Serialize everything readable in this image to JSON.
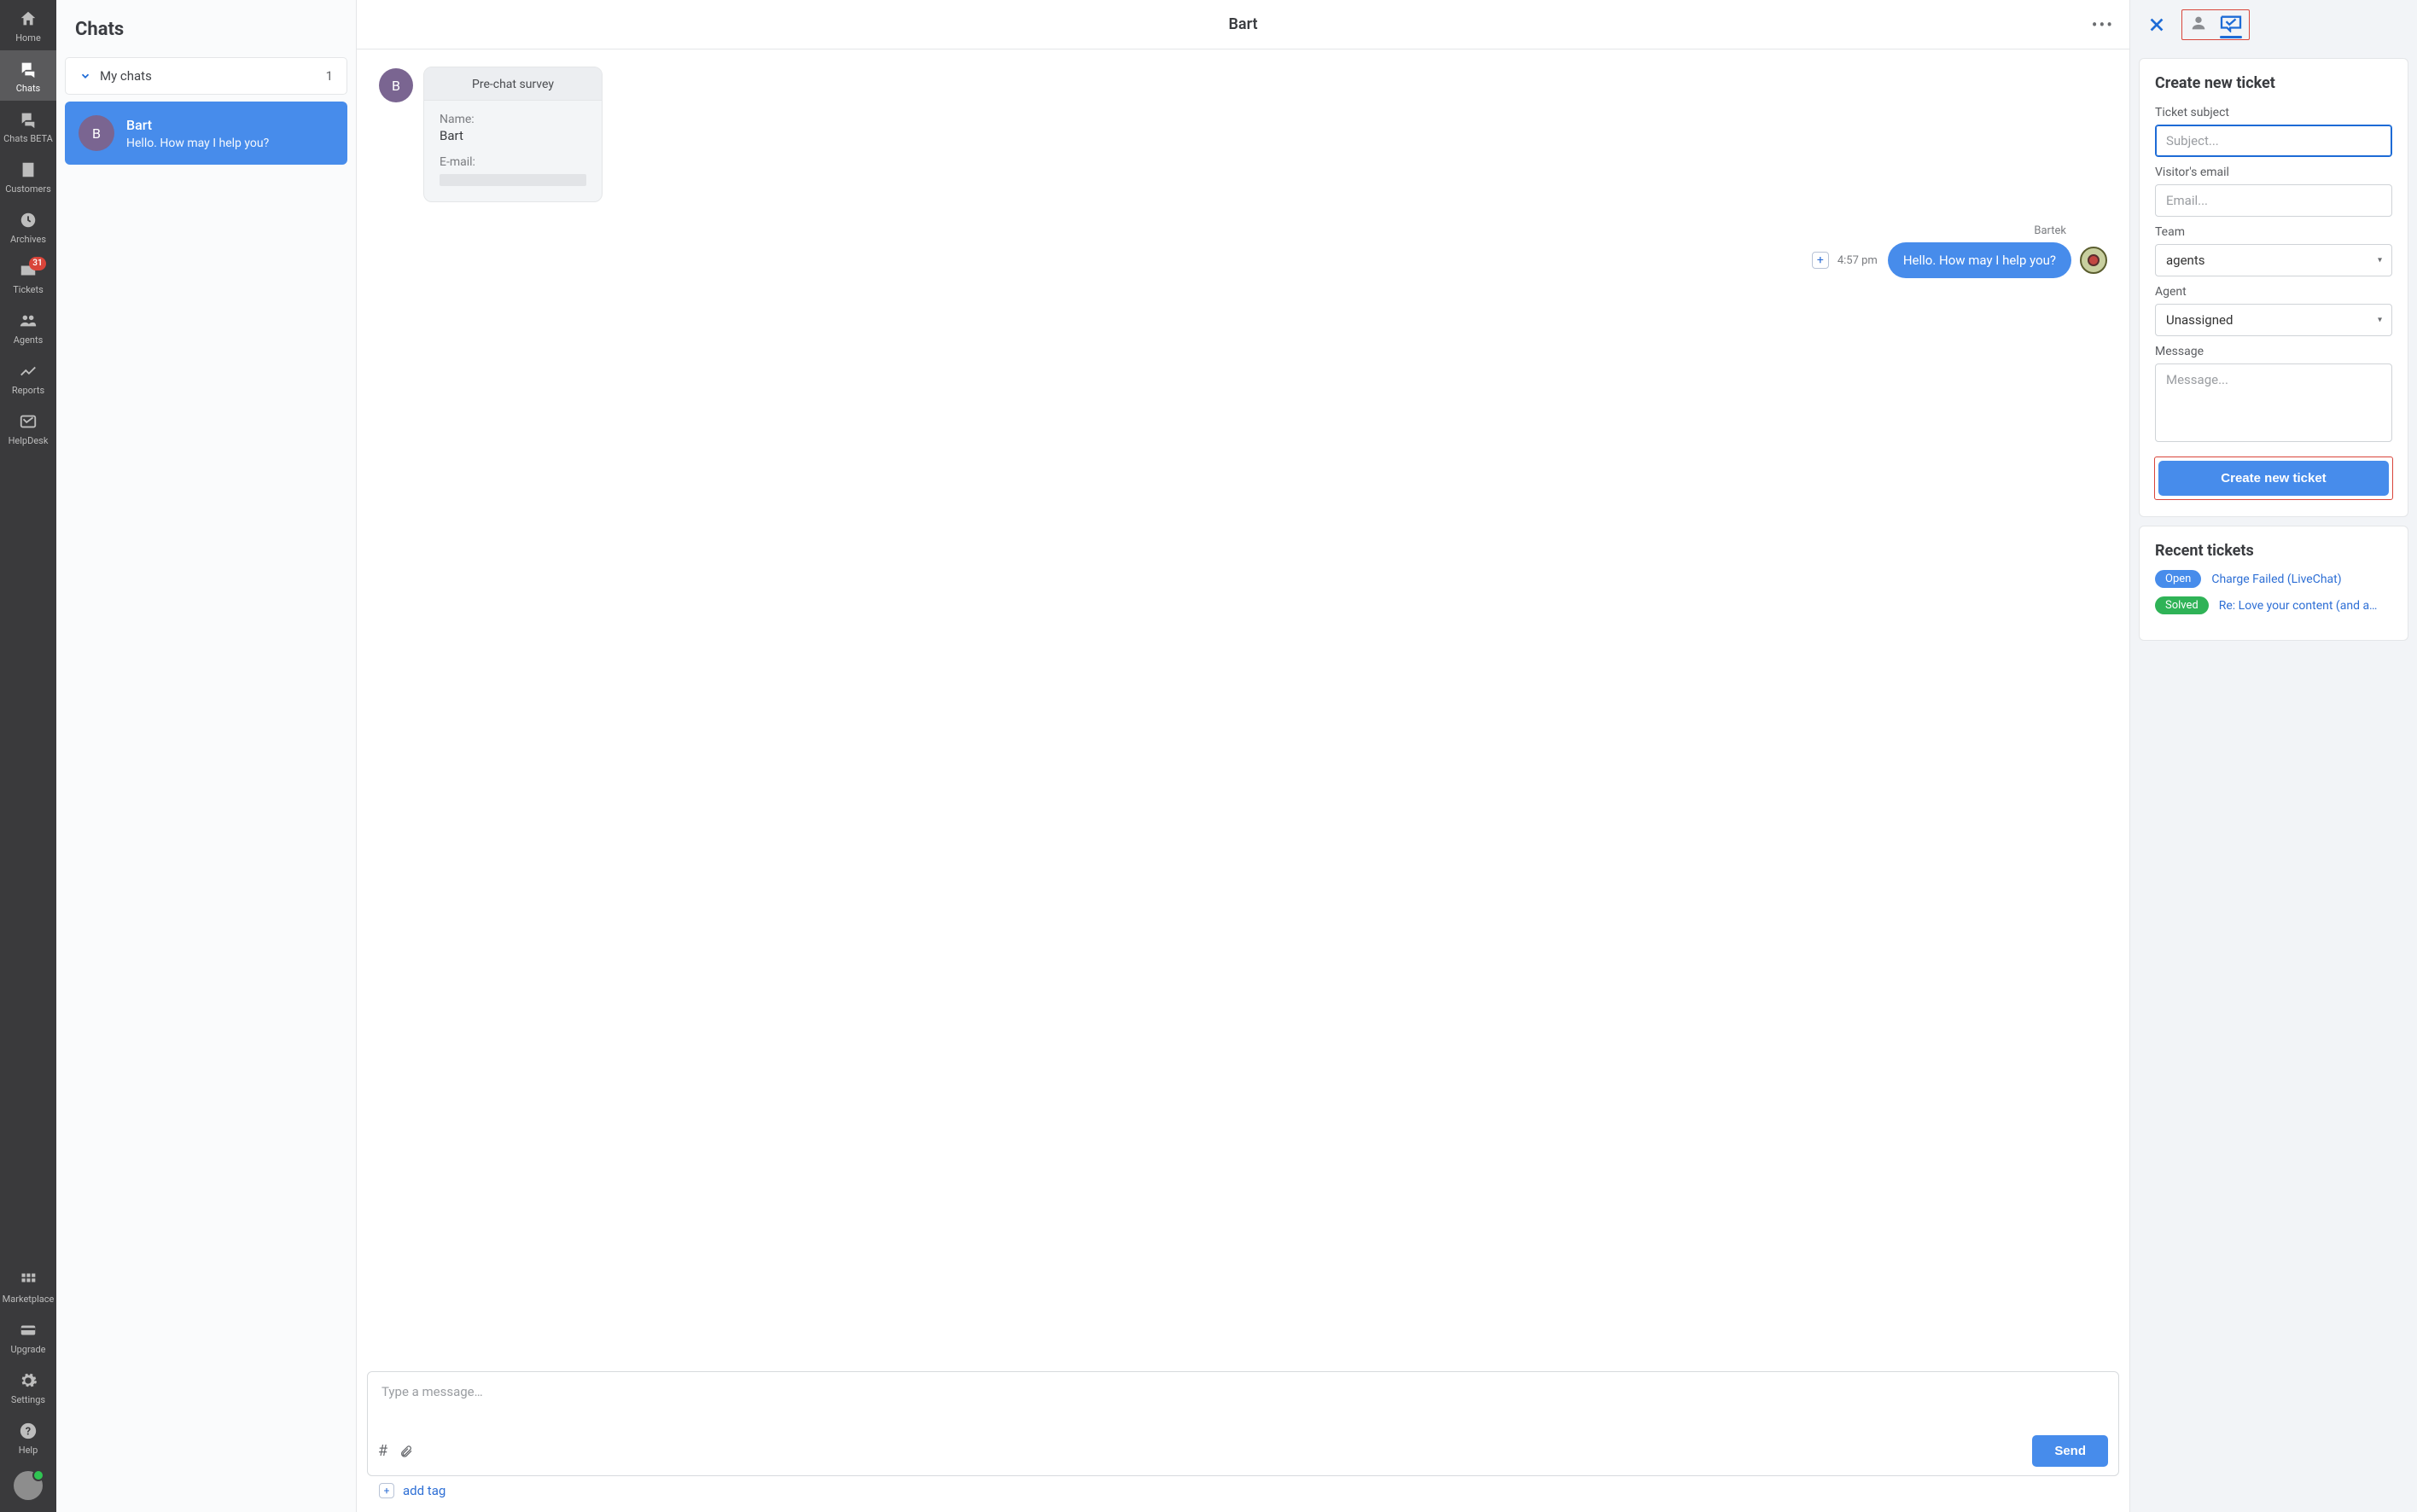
{
  "nav": {
    "items": [
      {
        "label": "Home"
      },
      {
        "label": "Chats"
      },
      {
        "label": "Chats BETA"
      },
      {
        "label": "Customers"
      },
      {
        "label": "Archives"
      },
      {
        "label": "Tickets",
        "badge": "31"
      },
      {
        "label": "Agents"
      },
      {
        "label": "Reports"
      },
      {
        "label": "HelpDesk"
      }
    ],
    "bottom": [
      {
        "label": "Marketplace"
      },
      {
        "label": "Upgrade"
      },
      {
        "label": "Settings"
      },
      {
        "label": "Help"
      }
    ]
  },
  "chatList": {
    "title": "Chats",
    "group": {
      "label": "My chats",
      "count": "1"
    },
    "active": {
      "initial": "B",
      "name": "Bart",
      "preview": "Hello. How may I help you?"
    }
  },
  "conversation": {
    "title": "Bart",
    "survey": {
      "initial": "B",
      "head": "Pre-chat survey",
      "name_label": "Name:",
      "name_value": "Bart",
      "email_label": "E-mail:"
    },
    "out": {
      "sender": "Bartek",
      "time": "4:57 pm",
      "text": "Hello. How may I help you?"
    },
    "input_placeholder": "Type a message…",
    "send": "Send",
    "hash": "#",
    "add_tag": "add tag"
  },
  "ticketPanel": {
    "title": "Create new ticket",
    "subject_label": "Ticket subject",
    "subject_placeholder": "Subject...",
    "email_label": "Visitor's email",
    "email_placeholder": "Email...",
    "team_label": "Team",
    "team_value": "agents",
    "agent_label": "Agent",
    "agent_value": "Unassigned",
    "message_label": "Message",
    "message_placeholder": "Message...",
    "submit": "Create new ticket"
  },
  "recent": {
    "title": "Recent tickets",
    "items": [
      {
        "status": "Open",
        "class": "open",
        "title": "Charge Failed (LiveChat)"
      },
      {
        "status": "Solved",
        "class": "solved",
        "title": "Re: Love your content (and a…"
      }
    ]
  }
}
